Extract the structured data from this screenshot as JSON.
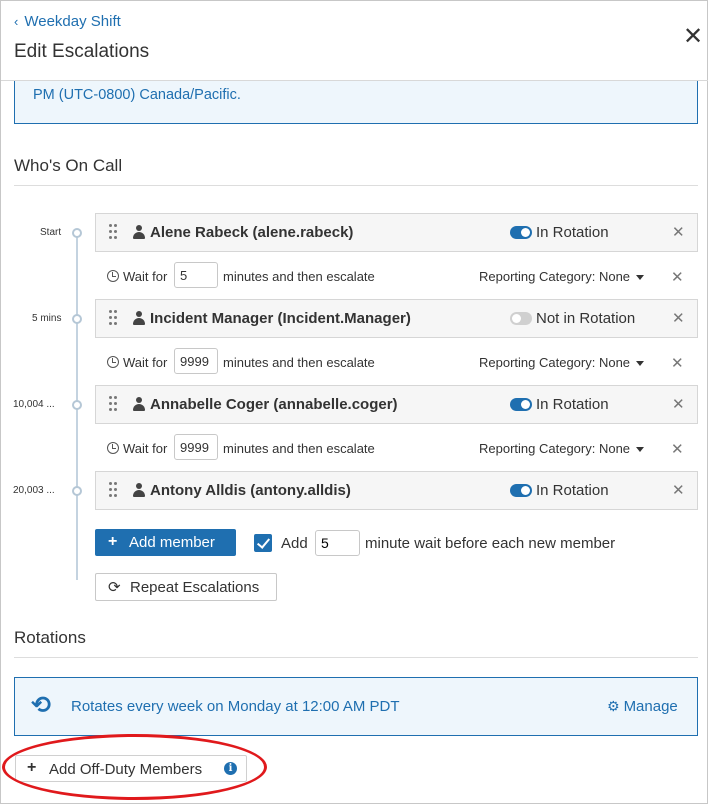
{
  "header": {
    "back_label": "Weekday Shift",
    "title": "Edit Escalations"
  },
  "info_banner": {
    "text": "PM (UTC-0800) Canada/Pacific."
  },
  "whos_on_call": {
    "heading": "Who's On Call",
    "members": [
      {
        "time_label": "Start",
        "name": "Alene Rabeck (alene.rabeck)",
        "rotation_status": "In Rotation",
        "in_rotation": true
      },
      {
        "time_label": "5 mins",
        "name": "Incident Manager (Incident.Manager)",
        "rotation_status": "Not in Rotation",
        "in_rotation": false
      },
      {
        "time_label": "10,004 ...",
        "name": "Annabelle Coger (annabelle.coger)",
        "rotation_status": "In Rotation",
        "in_rotation": true
      },
      {
        "time_label": "20,003 ...",
        "name": "Antony Alldis (antony.alldis)",
        "rotation_status": "In Rotation",
        "in_rotation": true
      }
    ],
    "waits": [
      {
        "prefix": "Wait for",
        "minutes": "5",
        "suffix": "minutes and then escalate",
        "reporting": "Reporting Category: None"
      },
      {
        "prefix": "Wait for",
        "minutes": "9999",
        "suffix": "minutes and then escalate",
        "reporting": "Reporting Category: None"
      },
      {
        "prefix": "Wait for",
        "minutes": "9999",
        "suffix": "minutes and then escalate",
        "reporting": "Reporting Category: None"
      }
    ],
    "add_member_label": "Add member",
    "add_wait": {
      "checked": true,
      "prefix": "Add",
      "minutes": "5",
      "suffix": "minute wait before each new member"
    },
    "repeat_label": "Repeat Escalations"
  },
  "rotations": {
    "heading": "Rotations",
    "description": "Rotates every week on Monday at 12:00 AM PDT",
    "manage_label": "Manage"
  },
  "off_duty": {
    "label": "Add Off-Duty Members"
  },
  "colors": {
    "accent": "#1f6fb0",
    "highlight_ellipse": "#e0191c",
    "info_background": "#eef6fc"
  },
  "icons": {
    "back": "chevron-left-icon",
    "close": "close-icon",
    "drag": "drag-handle-icon",
    "user": "user-icon",
    "clock": "clock-icon",
    "remove": "remove-icon",
    "refresh": "refresh-icon",
    "sync": "sync-icon",
    "gear": "gear-icon",
    "info": "info-icon"
  }
}
